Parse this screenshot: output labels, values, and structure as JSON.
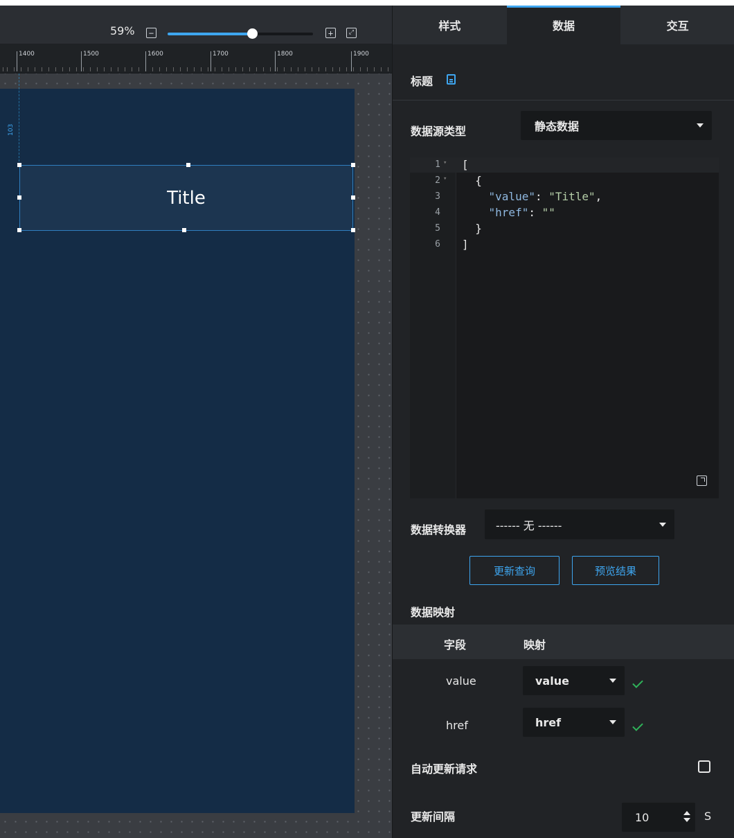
{
  "canvas": {
    "zoom_label": "59%",
    "zoom_level": 0.59,
    "ruler_labels": [
      "1400",
      "1500",
      "1600",
      "1700",
      "1800",
      "1900"
    ],
    "v_ruler_marker": "103",
    "selected_component_text": "Title"
  },
  "panel": {
    "tabs": [
      {
        "label": "样式",
        "active": false
      },
      {
        "label": "数据",
        "active": true
      },
      {
        "label": "交互",
        "active": false
      }
    ],
    "section_title": "标题",
    "datasource_label": "数据源类型",
    "datasource_value": "静态数据",
    "code_lines": [
      "[",
      "  {",
      "    \"value\": \"Title\",",
      "    \"href\": \"\"",
      "  }",
      "]"
    ],
    "converter_label": "数据转换器",
    "converter_value": "------ 无 ------",
    "buttons": {
      "refresh": "更新查询",
      "preview": "预览结果"
    },
    "mapping_title": "数据映射",
    "mapping_columns": {
      "field": "字段",
      "mapping": "映射"
    },
    "mapping_rows": [
      {
        "field": "value",
        "mapping": "value"
      },
      {
        "field": "href",
        "mapping": "href"
      }
    ],
    "auto_update_label": "自动更新请求",
    "auto_update_checked": false,
    "interval_label": "更新间隔",
    "interval_value": "10",
    "interval_unit": "S"
  },
  "colors": {
    "accent": "#3ea6f0",
    "page_background": "#142c46",
    "panel_background": "#212326",
    "success": "#2fb35a"
  }
}
